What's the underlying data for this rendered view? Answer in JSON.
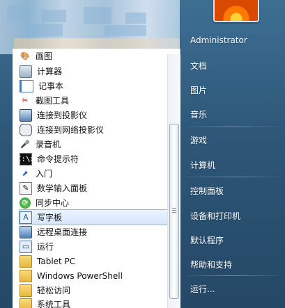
{
  "programs": [
    {
      "label": "画图",
      "icon": "paint-icon"
    },
    {
      "label": "计算器",
      "icon": "calculator-icon"
    },
    {
      "label": "记事本",
      "icon": "notepad-icon"
    },
    {
      "label": "截图工具",
      "icon": "snipping-tool-icon"
    },
    {
      "label": "连接到投影仪",
      "icon": "projector-icon"
    },
    {
      "label": "连接到网络投影仪",
      "icon": "network-projector-icon"
    },
    {
      "label": "录音机",
      "icon": "microphone-icon"
    },
    {
      "label": "命令提示符",
      "icon": "command-prompt-icon"
    },
    {
      "label": "入门",
      "icon": "getting-started-icon"
    },
    {
      "label": "数学输入面板",
      "icon": "math-input-panel-icon"
    },
    {
      "label": "同步中心",
      "icon": "sync-center-icon"
    },
    {
      "label": "写字板",
      "icon": "wordpad-icon"
    },
    {
      "label": "远程桌面连接",
      "icon": "remote-desktop-icon"
    },
    {
      "label": "运行",
      "icon": "run-icon"
    },
    {
      "label": "Tablet PC",
      "icon": "folder-icon"
    },
    {
      "label": "Windows PowerShell",
      "icon": "folder-icon"
    },
    {
      "label": "轻松访问",
      "icon": "folder-icon"
    },
    {
      "label": "系统工具",
      "icon": "folder-icon"
    }
  ],
  "selected_program": "写字板",
  "cmd_icon_text": "C:\\>",
  "right_panel": {
    "user_name": "Administrator",
    "items": [
      "文档",
      "图片",
      "音乐",
      "游戏",
      "计算机",
      "控制面板",
      "设备和打印机",
      "默认程序",
      "帮助和支持",
      "运行..."
    ]
  },
  "colors": {
    "selection_fill": "#d5e7fb",
    "selection_border": "#86b6e6",
    "right_panel_bg": "#2d5677"
  }
}
